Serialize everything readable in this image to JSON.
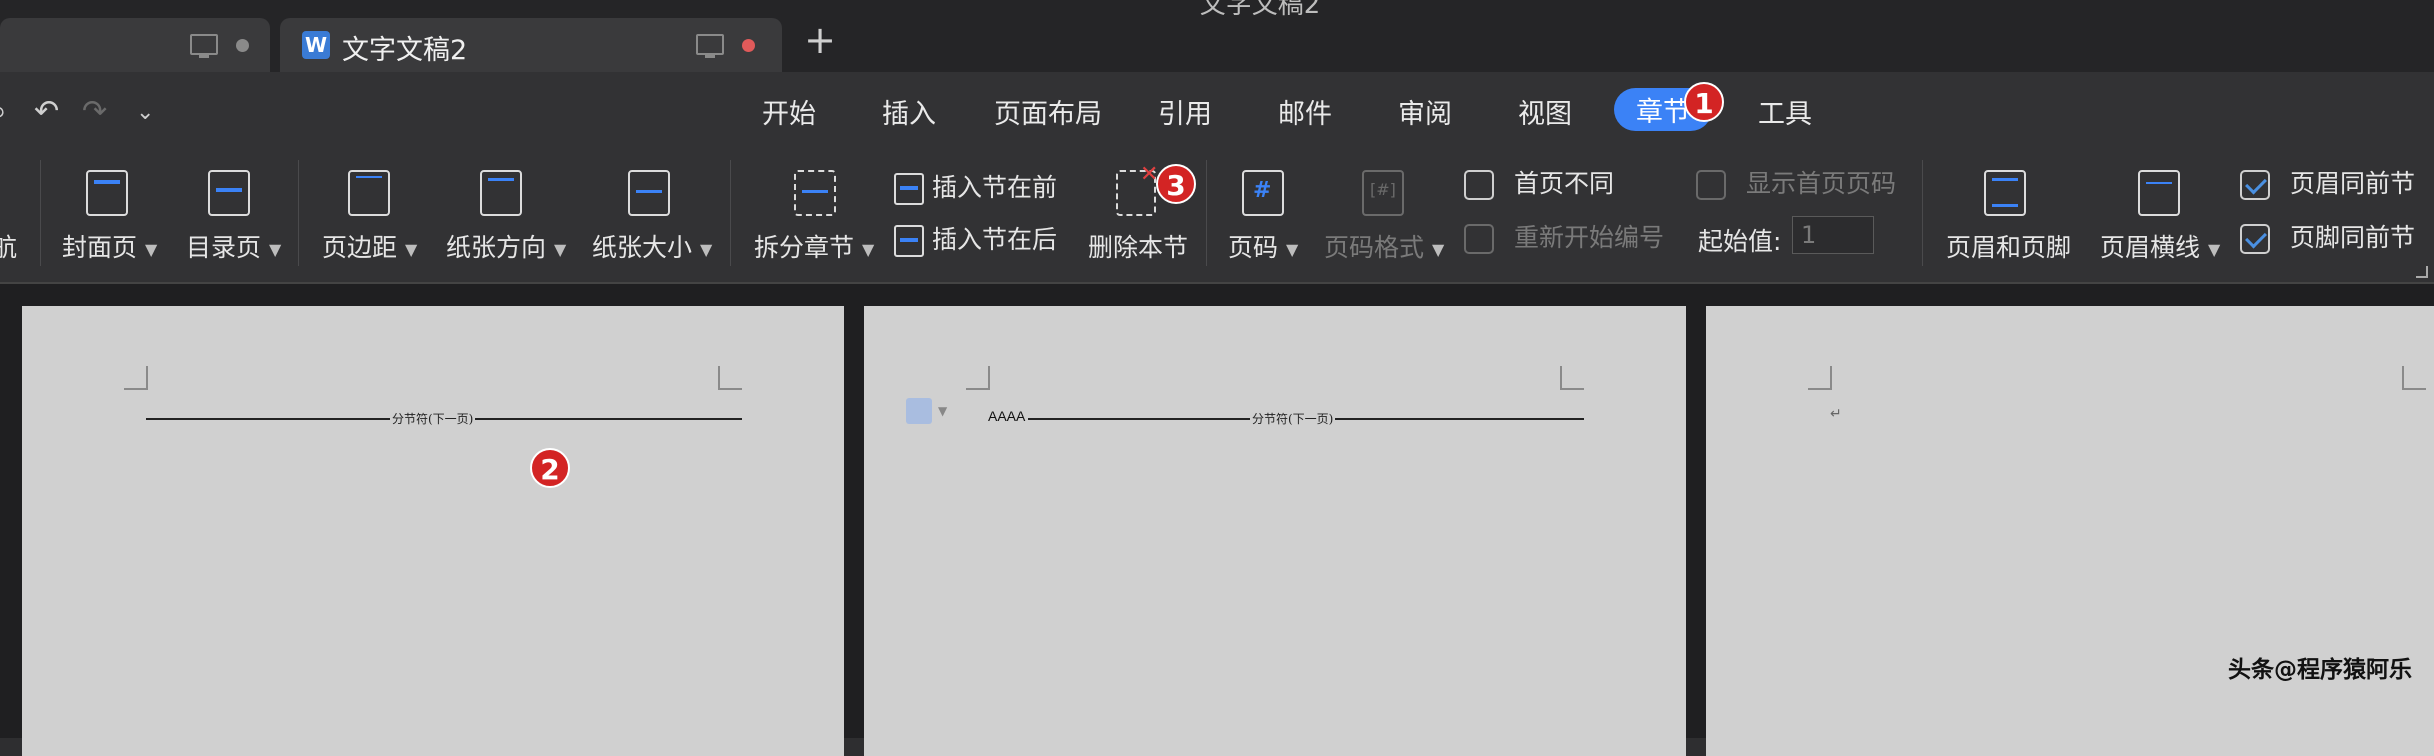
{
  "window": {
    "title": "文字文稿2"
  },
  "tabs": [
    {
      "label": ""
    },
    {
      "label": "文字文稿2",
      "icon": "wps-writer-icon"
    }
  ],
  "new_tab_label": "+",
  "menu": {
    "items": [
      "开始",
      "插入",
      "页面布局",
      "引用",
      "邮件",
      "审阅",
      "视图",
      "章节",
      "工具"
    ],
    "active": "章节"
  },
  "badges": {
    "b1": "1",
    "b2": "2",
    "b3": "3"
  },
  "ribbon": {
    "nav_partial": "航",
    "cover_page": "封面页",
    "toc_page": "目录页",
    "margins": "页边距",
    "orientation": "纸张方向",
    "paper_size": "纸张大小",
    "split_section": "拆分章节",
    "insert_section_before": "插入节在前",
    "insert_section_after": "插入节在后",
    "delete_section": "删除本节",
    "page_number": "页码",
    "page_number_format": "页码格式",
    "different_first_page": "首页不同",
    "restart_numbering": "重新开始编号",
    "show_first_page_number": "显示首页页码",
    "start_value_label": "起始值:",
    "start_value": "1",
    "header_footer": "页眉和页脚",
    "header_line": "页眉横线",
    "header_same_as_previous": "页眉同前节",
    "footer_same_as_previous": "页脚同前节"
  },
  "checkboxes": {
    "different_first_page": false,
    "restart_numbering": false,
    "show_first_page_number": false,
    "header_same_as_previous": true,
    "footer_same_as_previous": true
  },
  "document": {
    "page1_break": "分节符(下一页)",
    "page2_text": "AAAA",
    "page2_break": "分节符(下一页)",
    "paragraph_mark": "↵"
  },
  "watermark": "头条@程序猿阿乐",
  "colors": {
    "accent": "#3b82f6",
    "badge": "#d32424",
    "tab_dot": "#e05a5a"
  }
}
